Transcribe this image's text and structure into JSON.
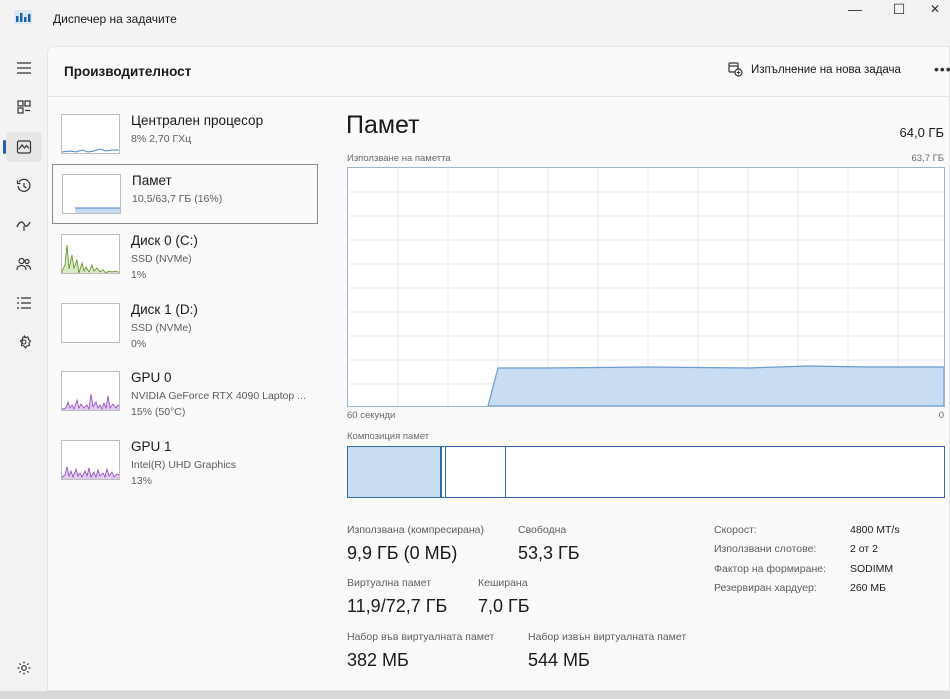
{
  "window": {
    "title": "Диспечер на задачите",
    "minimize": "—",
    "maximize": "☐",
    "close": "✕"
  },
  "nav": {
    "items": [
      {
        "icon": "hamburger-menu-icon"
      },
      {
        "icon": "processes-icon"
      },
      {
        "icon": "performance-icon"
      },
      {
        "icon": "app-history-icon"
      },
      {
        "icon": "startup-apps-icon"
      },
      {
        "icon": "users-icon"
      },
      {
        "icon": "details-icon"
      },
      {
        "icon": "services-icon"
      },
      {
        "icon": "settings-icon"
      }
    ]
  },
  "header": {
    "title": "Производителност",
    "run_task": "Изпълнение на нова задача",
    "more": "•••"
  },
  "devices": [
    {
      "name": "Централен процесор",
      "line1": "8%  2,70 ГХц",
      "line2": ""
    },
    {
      "name": "Памет",
      "line1": "10,5/63,7 ГБ (16%)",
      "line2": ""
    },
    {
      "name": "Диск 0 (C:)",
      "line1": "SSD (NVMe)",
      "line2": "1%"
    },
    {
      "name": "Диск 1 (D:)",
      "line1": "SSD (NVMe)",
      "line2": "0%"
    },
    {
      "name": "GPU 0",
      "line1": "NVIDIA GeForce RTX 4090 Laptop ...",
      "line2": "15% (50°C)"
    },
    {
      "name": "GPU 1",
      "line1": "Intel(R) UHD Graphics",
      "line2": "13%"
    }
  ],
  "memory": {
    "title": "Памет",
    "total": "64,0 ГБ",
    "usage_label": "Използване на паметта",
    "usage_max": "63,7 ГБ",
    "time_left": "60 секунди",
    "time_right": "0",
    "composition_label": "Композиция памет",
    "usage_fraction": 0.16
  },
  "stats": {
    "used_label": "Използвана (компресирана)",
    "used_value": "9,9 ГБ (0 МБ)",
    "free_label": "Свободна",
    "free_value": "53,3 ГБ",
    "virtual_label": "Виртуална памет",
    "virtual_value": "11,9/72,7 ГБ",
    "cached_label": "Кеширана",
    "cached_value": "7,0 ГБ",
    "paged_label": "Набор във виртуалната памет",
    "paged_value": "382 МБ",
    "nonpaged_label": "Набор извън виртуалната памет",
    "nonpaged_value": "544 МБ"
  },
  "specs": [
    {
      "label": "Скорост:",
      "value": "4800 MT/s"
    },
    {
      "label": "Използвани слотове:",
      "value": "2 от 2"
    },
    {
      "label": "Фактор на формиране:",
      "value": "SODIMM"
    },
    {
      "label": "Резервиран хардуер:",
      "value": "260 МБ"
    }
  ],
  "colors": {
    "accent": "#1f5fae",
    "memory_fill": "#c8dcf2",
    "memory_line": "#6b9bd1",
    "disk_line": "#5a8c1e",
    "gpu_line": "#8e44c4"
  }
}
